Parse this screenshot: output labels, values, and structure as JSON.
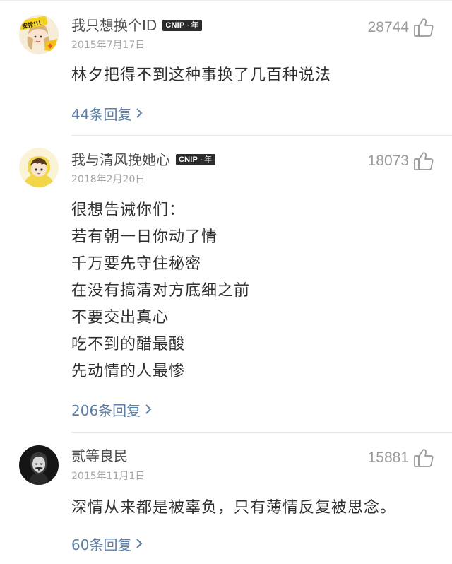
{
  "comments": [
    {
      "username": "我只想换个ID",
      "vip": {
        "cn": "CN",
        "ip": "IP",
        "sep": "·",
        "year": "年"
      },
      "date": "2015年7月17日",
      "likes": "28744",
      "lines": [
        "林夕把得不到这种事换了几百种说法"
      ],
      "reply_label": "44条回复",
      "avatar_text": "安排!!!"
    },
    {
      "username": "我与清风挽她心",
      "vip": {
        "cn": "CN",
        "ip": "IP",
        "sep": "·",
        "year": "年"
      },
      "date": "2018年2月20日",
      "likes": "18073",
      "lines": [
        "很想告诫你们：",
        "若有朝一日你动了情",
        "千万要先守住秘密",
        "在没有搞清对方底细之前",
        "不要交出真心",
        "吃不到的醋最酸",
        "先动情的人最惨"
      ],
      "reply_label": "206条回复"
    },
    {
      "username": "贰等良民",
      "date": "2015年11月1日",
      "likes": "15881",
      "lines": [
        "深情从来都是被辜负，只有薄情反复被思念。"
      ],
      "reply_label": "60条回复"
    }
  ],
  "icons": {
    "like": "thumbs-up-icon",
    "reply_chevron": "chevron-right-icon"
  },
  "colors": {
    "username": "#4d4d4d",
    "date": "#a6a6a6",
    "likes": "#9a9a9a",
    "content": "#2e2e2e",
    "reply_link": "#5b7fa6",
    "vip_badge_bg": "#2b2b2b"
  }
}
